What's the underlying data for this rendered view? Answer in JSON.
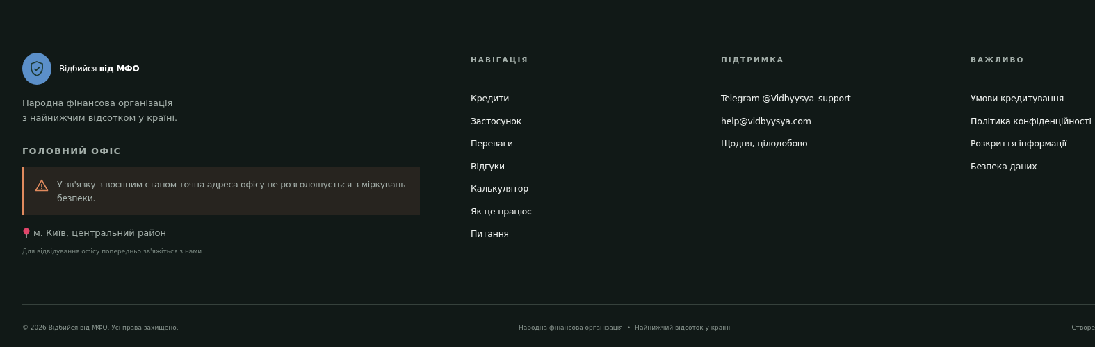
{
  "brand": {
    "name": "Відбийся **від МФО**",
    "tagline": [
      "Народна фінансова організація",
      "з найнижчим відсотком у країні."
    ]
  },
  "office": {
    "heading": "ГОЛОВНИЙ ОФІС",
    "warning": "У зв'язку з воєнним станом точна адреса офісу не розголошується з міркувань безпеки.",
    "address": "м. Київ, центральний район",
    "note": "Для відвідування офісу попередньо зв'яжіться з нами"
  },
  "columns": [
    {
      "heading": "НАВІГАЦІЯ",
      "links": [
        "Кредити",
        "Застосунок",
        "Переваги",
        "Відгуки",
        "Калькулятор",
        "Як це працює",
        "Питання"
      ]
    },
    {
      "heading": "ПІДТРИМКА",
      "links": [
        "Telegram @Vidbyysya_support",
        "help@vidbyysya.com",
        "Щодня, цілодобово"
      ]
    },
    {
      "heading": "ВАЖЛИВО",
      "links": [
        "Умови кредитування",
        "Політика конфіденційності",
        "Розкриття інформації",
        "Безпека даних"
      ]
    }
  ],
  "bottom": {
    "copyright": "© 2026 Відбийся від МФО. Усі права захищено.",
    "middle": [
      "Народна фінансова організація",
      "Найнижчий відсоток у країні"
    ],
    "separator": "•",
    "right": "Створе"
  }
}
